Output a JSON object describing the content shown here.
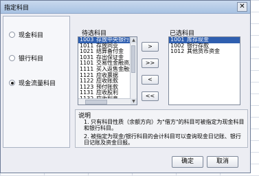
{
  "window": {
    "title": "指定科目",
    "close_label": "✕"
  },
  "radios": [
    {
      "label": "现金科目",
      "selected": false
    },
    {
      "label": "银行科目",
      "selected": false
    },
    {
      "label": "现金流量科目",
      "selected": true
    }
  ],
  "candidates": {
    "label": "待选科目",
    "items": [
      {
        "code": "1003",
        "name": "存放中央银行款",
        "selected": true
      },
      {
        "code": "1011",
        "name": "存放同业",
        "selected": false
      },
      {
        "code": "1021",
        "name": "结算备付金",
        "selected": false
      },
      {
        "code": "1031",
        "name": "存出保证金",
        "selected": false
      },
      {
        "code": "1101",
        "name": "交易性金融资产",
        "selected": false
      },
      {
        "code": "1111",
        "name": "买入返售金融资",
        "selected": false
      },
      {
        "code": "1121",
        "name": "应收票据",
        "selected": false
      },
      {
        "code": "1122",
        "name": "应收账款",
        "selected": false
      },
      {
        "code": "1123",
        "name": "预付账款",
        "selected": false
      },
      {
        "code": "1131",
        "name": "应收股利",
        "selected": false
      },
      {
        "code": "1132",
        "name": "应收利息",
        "selected": false
      }
    ]
  },
  "selected_list": {
    "label": "已选科目",
    "items": [
      {
        "code": "1001",
        "name": "库存现金",
        "selected": true
      },
      {
        "code": "1002",
        "name": "银行存款",
        "selected": false
      },
      {
        "code": "1012",
        "name": "其他货币资金",
        "selected": false
      }
    ]
  },
  "move_buttons": {
    "add_one": ">",
    "add_all": ">>",
    "remove_one": "<",
    "remove_all": "<<"
  },
  "note": {
    "title": "说明",
    "line1": "1. 只有科目性质（余额方向）为\"借方\"的科目可被指定为现金科目和银行科目。",
    "line2": "2. 被指定为现金/银行科目的会计科目可以查询现金日记账、银行日记账及资金日报。"
  },
  "buttons": {
    "ok": "确定",
    "cancel": "取消"
  },
  "colors": {
    "selection": "#2f5fb0",
    "dialog_bg": "#ecedf3",
    "titlebar": "#a8c2e2"
  }
}
